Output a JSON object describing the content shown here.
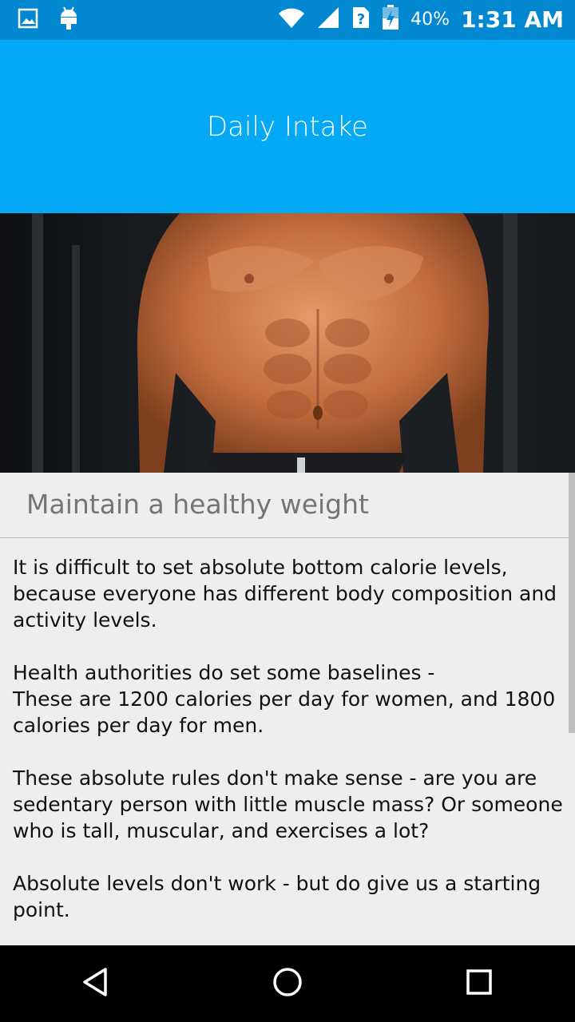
{
  "status_bar": {
    "battery_percent": "40%",
    "time": "1:31 AM",
    "icons": [
      "image-icon",
      "android-icon",
      "wifi-icon",
      "cell-signal-icon",
      "sim-unknown-icon",
      "battery-charging-icon"
    ]
  },
  "app_bar": {
    "title": "Daily Intake"
  },
  "hero": {
    "icon": "muscular-torso-photo"
  },
  "content": {
    "section_title": "Maintain a healthy weight",
    "paragraphs": [
      "It is difficult to set absolute bottom calorie levels, because everyone has different body composition and activity levels.",
      "Health authorities do set some baselines -",
      "These are 1200 calories per day for women, and 1800 calories per day for men.",
      "These absolute rules don't make sense - are you are sedentary person with little muscle mass? Or someone who is tall, muscular, and exercises a lot?",
      "Absolute levels don't work - but do give us a starting point."
    ]
  },
  "nav_bar": {
    "icons": [
      "back-icon",
      "home-icon",
      "recents-icon"
    ]
  },
  "colors": {
    "status_bar": "#0288d1",
    "app_bar": "#03a9f4",
    "background": "#eeeeee",
    "nav_bar": "#000000"
  }
}
